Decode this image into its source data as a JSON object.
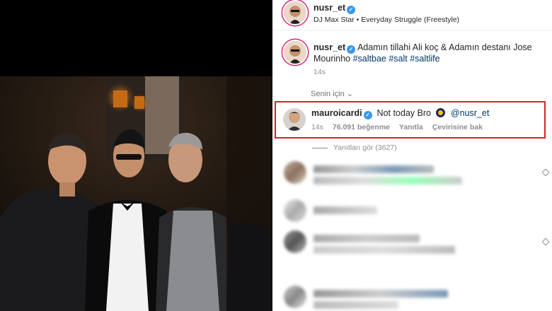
{
  "post": {
    "username": "nusr_et",
    "audio": "DJ Max Star • Everyday Struggle (Freestyle)"
  },
  "caption": {
    "username": "nusr_et",
    "text": "Adamın tillahi Ali koç & Adamın destanı Jose Mourinho",
    "hashtags": "#saltbae #salt #saltlife",
    "time": "14s"
  },
  "for_you_label": "Senin için",
  "highlighted_comment": {
    "username": "mauroicardi",
    "text": "Not today Bro",
    "mention": "@nusr_et",
    "time": "14s",
    "likes": "76.091 beğenme",
    "reply": "Yanıtla",
    "translate": "Çevirisine bak"
  },
  "view_replies": "Yanıtları gör (3627)",
  "colors": {
    "highlight_border": "#d3232b",
    "verified": "#3897f0",
    "link": "#00376b",
    "muted": "#8e8e8e"
  }
}
